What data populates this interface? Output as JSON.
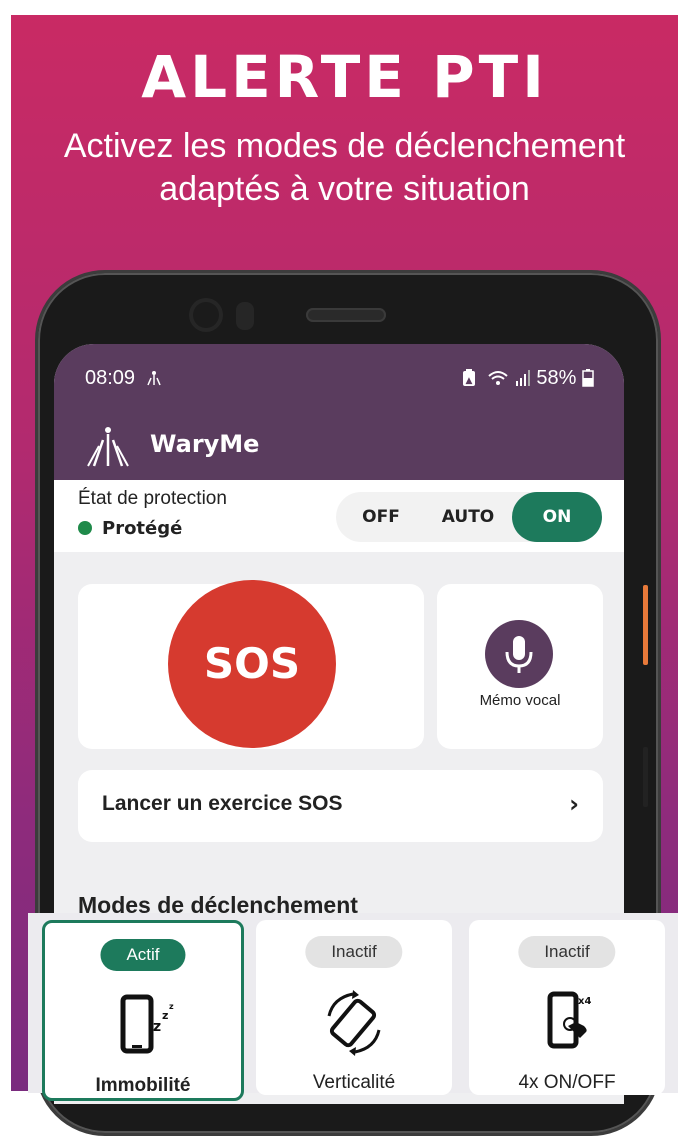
{
  "hero": {
    "headline": "ALERTE PTI",
    "subtitle_line1": "Activez les modes de déclenchement",
    "subtitle_line2": "adaptés à votre situation"
  },
  "status_bar": {
    "time": "08:09",
    "battery": "58%"
  },
  "app_bar": {
    "title": "WaryMe"
  },
  "protection": {
    "label": "État de protection",
    "state": "Protégé",
    "options": [
      "OFF",
      "AUTO",
      "ON"
    ],
    "selected": "ON"
  },
  "sos": {
    "label": "SOS"
  },
  "memo": {
    "label": "Mémo vocal"
  },
  "exercise": {
    "label": "Lancer un exercice SOS",
    "chevron": "›"
  },
  "modes": {
    "title": "Modes de déclenchement",
    "items": [
      {
        "badge": "Actif",
        "label": "Immobilité",
        "icon": "phone-sleep-icon"
      },
      {
        "badge": "Inactif",
        "label": "Verticalité",
        "icon": "phone-rotate-icon"
      },
      {
        "badge": "Inactif",
        "label": "4x ON/OFF",
        "icon": "phone-press-icon"
      }
    ]
  },
  "colors": {
    "brand": "#5a3c5e",
    "accent": "#1d7a5c",
    "sos": "#d63a2f",
    "hero_bg": "#c92a64"
  }
}
